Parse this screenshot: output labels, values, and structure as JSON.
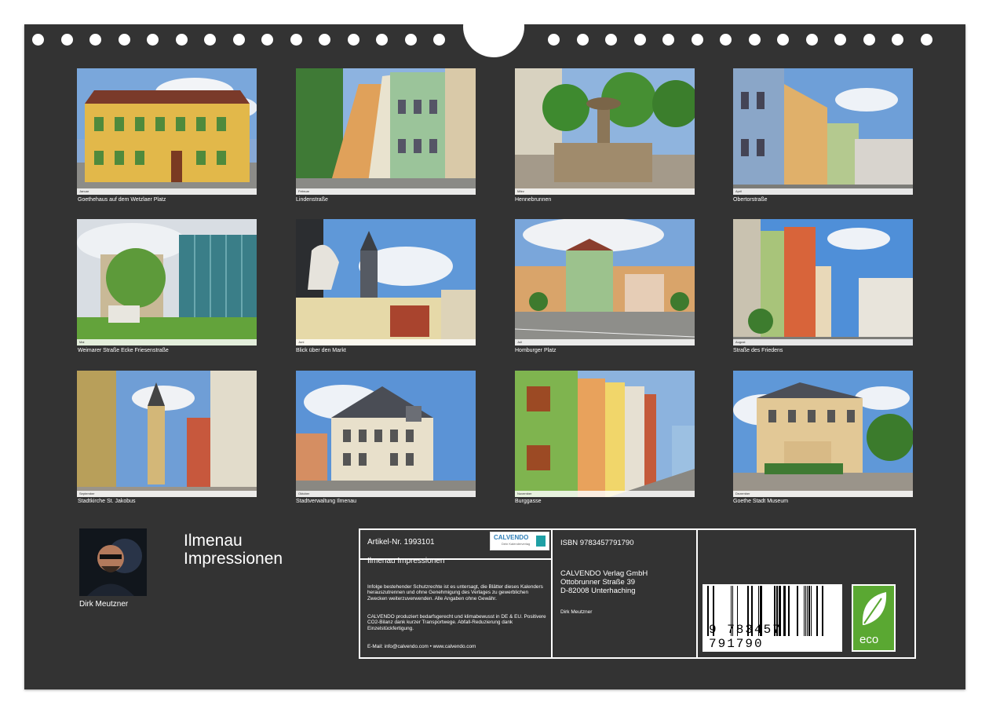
{
  "calendar": {
    "title_line1": "Ilmenau",
    "title_line2": "Impressionen",
    "author": "Dirk Meutzner",
    "photos": [
      {
        "caption": "Goethehaus auf dem Wetzlaer Platz",
        "month": "Januar"
      },
      {
        "caption": "Lindenstraße",
        "month": "Februar"
      },
      {
        "caption": "Hennebrunnen",
        "month": "März"
      },
      {
        "caption": "Obertorstraße",
        "month": "April"
      },
      {
        "caption": "Weimarer Straße Ecke Friesenstraße",
        "month": "Mai"
      },
      {
        "caption": "Blick über den Markt",
        "month": "Juni"
      },
      {
        "caption": "Homburger Platz",
        "month": "Juli"
      },
      {
        "caption": "Straße des Friedens",
        "month": "August"
      },
      {
        "caption": "Stadtkirche St. Jakobus",
        "month": "September"
      },
      {
        "caption": "Stadtverwaltung Ilmenau",
        "month": "Oktober"
      },
      {
        "caption": "Burggasse",
        "month": "November"
      },
      {
        "caption": "Goethe Stadt Museum",
        "month": "Dezember"
      }
    ]
  },
  "info": {
    "article": "Artikel-Nr. 1993101",
    "product_title": "Ilmenau Impressionen",
    "legal1": "Infolge bestehender Schutzrechte ist es untersagt, die Blätter dieses Kalenders herauszutrennen und ohne Genehmigung des Verlages zu gewerblichen Zwecken weiterzuverwenden. Alle Angaben ohne Gewähr.",
    "legal2": "CALVENDO produziert bedarfsgerecht und klimabewusst in DE & EU. Positivere CO2-Bilanz dank kurzer Transportwege. Abfall-Reduzierung dank Einzelstückfertigung.",
    "contact": "E-Mail: info@calvendo.com • www.calvendo.com",
    "isbn": "ISBN 9783457791790",
    "publisher": "CALVENDO Verlag GmbH",
    "street": "Ottobrunner Straße 39",
    "city": "D-82008 Unterhaching",
    "author_small": "Dirk Meutzner",
    "barcode_number": "9 783457 791790",
    "logo_text": "CALVENDO",
    "logo_sub": "Dein Kalenderverlag",
    "eco_label": "eco"
  },
  "colors": {
    "page": "#333333",
    "accent_green": "#5aa832",
    "logo_blue": "#2f7fb8"
  }
}
